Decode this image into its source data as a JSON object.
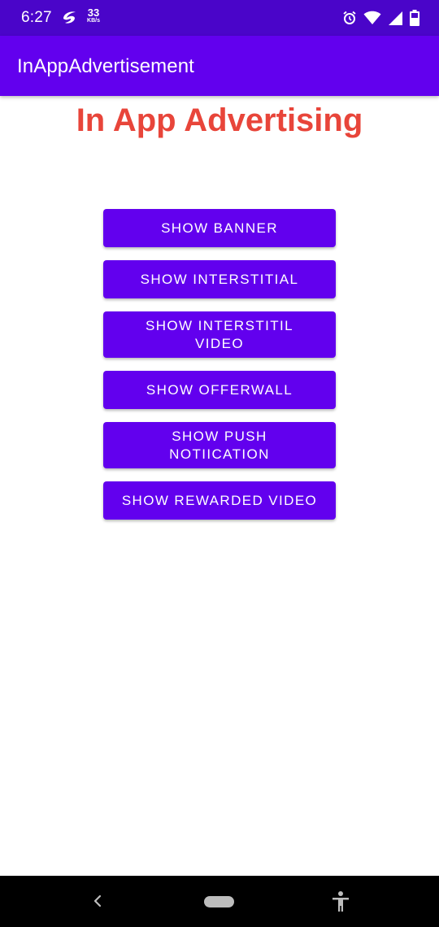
{
  "status_bar": {
    "time": "6:27",
    "speed_value": "33",
    "speed_unit": "KB/s",
    "icons": [
      "carrier-icon",
      "alarm-icon",
      "wifi-icon",
      "signal-icon",
      "battery-icon"
    ]
  },
  "app_bar": {
    "title": "InAppAdvertisement"
  },
  "main": {
    "headline": "In App Advertising",
    "buttons": [
      {
        "label": "SHOW BANNER"
      },
      {
        "label": "SHOW INTERSTITIAL"
      },
      {
        "line1": "SHOW INTERSTITIL",
        "line2": "VIDEO"
      },
      {
        "label": "SHOW OFFERWALL"
      },
      {
        "line1": "SHOW PUSH",
        "line2": "NOTIICATION"
      },
      {
        "label": "SHOW REWARDED VIDEO"
      }
    ]
  },
  "navigation_bar": {
    "icons": [
      "back-icon",
      "home-pill-icon",
      "accessibility-icon"
    ]
  },
  "colors": {
    "status_bar": "#4A05C9",
    "app_bar": "#6200EE",
    "button": "#6200EE",
    "headline": "#E8453A",
    "nav_bar": "#000000"
  }
}
